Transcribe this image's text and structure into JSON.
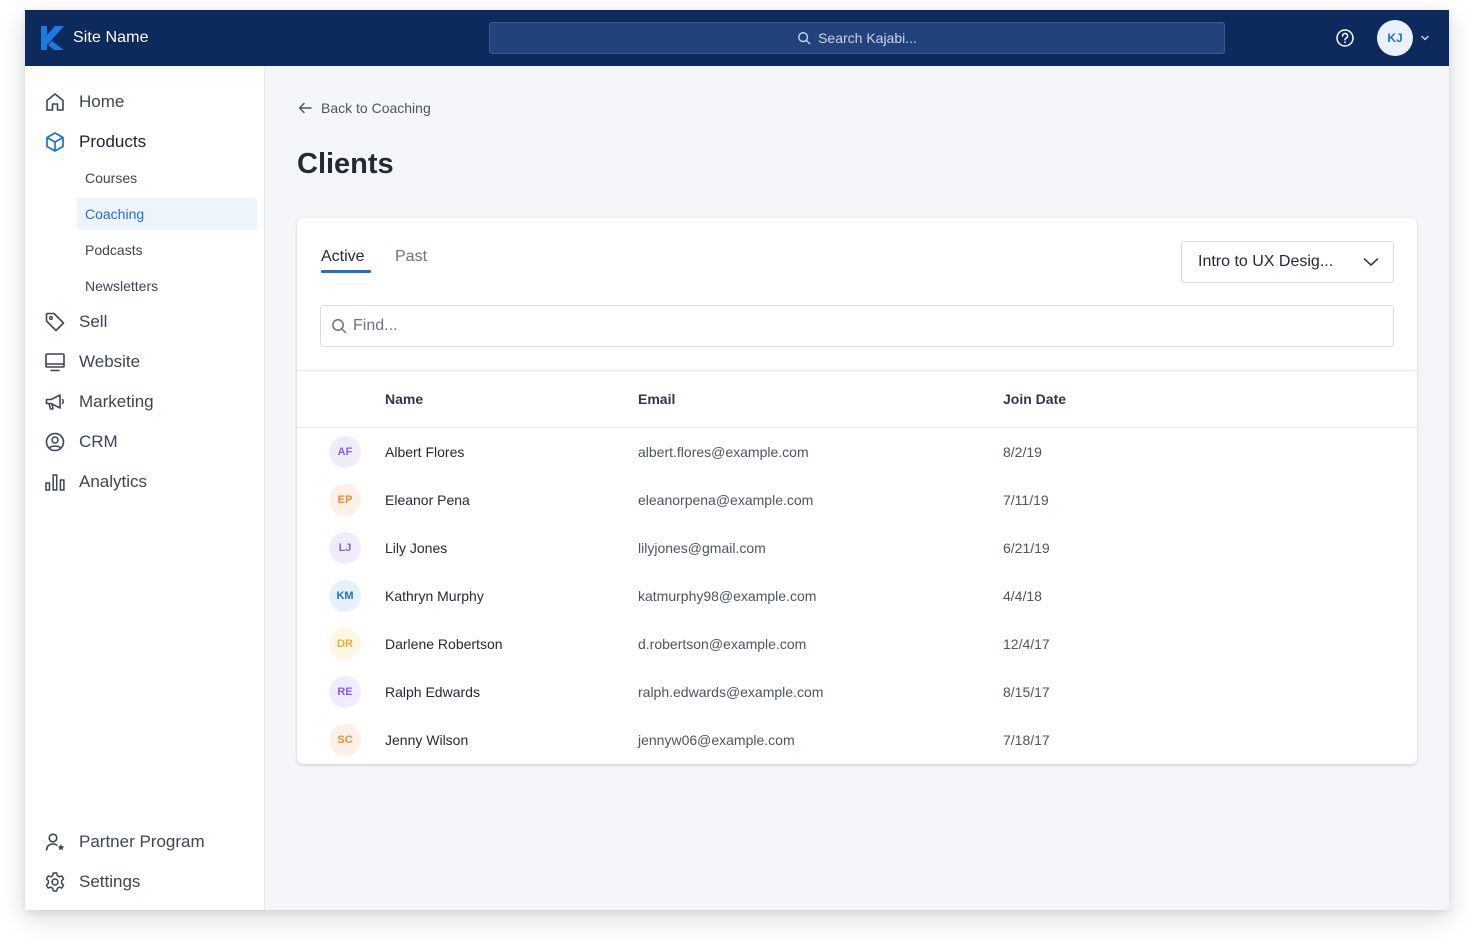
{
  "topbar": {
    "site_name": "Site Name",
    "search_placeholder": "Search Kajabi...",
    "user_initials": "KJ"
  },
  "sidebar": {
    "items": [
      {
        "label": "Home",
        "icon": "home-icon"
      },
      {
        "label": "Products",
        "icon": "box-icon"
      },
      {
        "label": "Sell",
        "icon": "tag-icon"
      },
      {
        "label": "Website",
        "icon": "monitor-icon"
      },
      {
        "label": "Marketing",
        "icon": "megaphone-icon"
      },
      {
        "label": "CRM",
        "icon": "user-circle-icon"
      },
      {
        "label": "Analytics",
        "icon": "bar-chart-icon"
      }
    ],
    "sub_items": [
      "Courses",
      "Coaching",
      "Podcasts",
      "Newsletters"
    ],
    "selected_sub_item": "Coaching",
    "bottom_items": [
      {
        "label": "Partner Program",
        "icon": "user-star-icon"
      },
      {
        "label": "Settings",
        "icon": "gear-icon"
      }
    ]
  },
  "main": {
    "back_label": "Back to Coaching",
    "title": "Clients",
    "tabs": [
      {
        "label": "Active",
        "active": true
      },
      {
        "label": "Past",
        "active": false
      }
    ],
    "product_select": "Intro to UX Desig...",
    "find_placeholder": "Find...",
    "columns": [
      "Name",
      "Email",
      "Join Date"
    ],
    "rows": [
      {
        "initials": "AF",
        "name": "Albert Flores",
        "email": "albert.flores@example.com",
        "join_date": "8/2/19",
        "avatar_bg": "#f1ecfb",
        "avatar_fg": "#8b5cf6"
      },
      {
        "initials": "EP",
        "name": "Eleanor Pena",
        "email": "eleanorpena@example.com",
        "join_date": "7/11/19",
        "avatar_bg": "#fdf0e6",
        "avatar_fg": "#f08a3c"
      },
      {
        "initials": "LJ",
        "name": "Lily Jones",
        "email": "lilyjones@gmail.com",
        "join_date": "6/21/19",
        "avatar_bg": "#f1ecfb",
        "avatar_fg": "#8b5cf6"
      },
      {
        "initials": "KM",
        "name": "Kathryn Murphy",
        "email": "katmurphy98@example.com",
        "join_date": "4/4/18",
        "avatar_bg": "#e6f1fc",
        "avatar_fg": "#1f6fd1"
      },
      {
        "initials": "DR",
        "name": "Darlene Robertson",
        "email": "d.robertson@example.com",
        "join_date": "12/4/17",
        "avatar_bg": "#fdf7e3",
        "avatar_fg": "#e0b22e"
      },
      {
        "initials": "RE",
        "name": "Ralph Edwards",
        "email": "ralph.edwards@example.com",
        "join_date": "8/15/17",
        "avatar_bg": "#f1ecfb",
        "avatar_fg": "#8b5cf6"
      },
      {
        "initials": "SC",
        "name": "Jenny Wilson",
        "email": "jennyw06@example.com",
        "join_date": "7/18/17",
        "avatar_bg": "#fdf0e6",
        "avatar_fg": "#f08a3c"
      }
    ]
  },
  "colors": {
    "topbar_bg": "#0d2a5c",
    "accent": "#1f6fd1",
    "page_bg": "#f4f6f9"
  }
}
